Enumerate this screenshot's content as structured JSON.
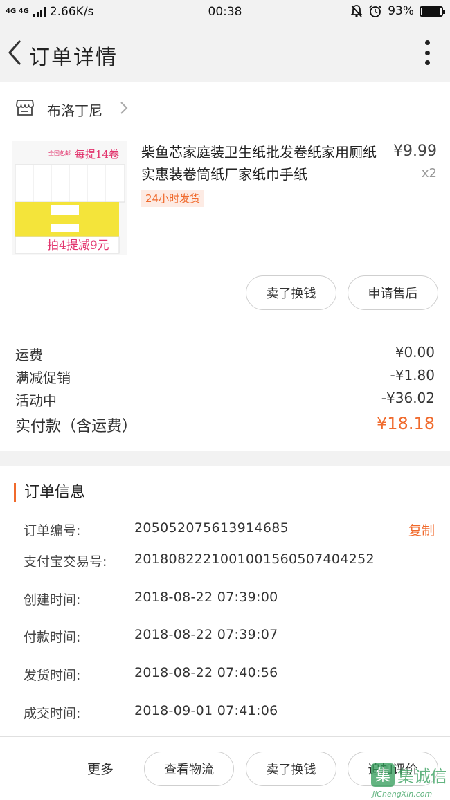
{
  "status_bar": {
    "signal": "4G 4G",
    "speed": "2.66K/s",
    "time": "00:38",
    "battery": "93%",
    "battery_level": 0.93
  },
  "header": {
    "title": "订单详情"
  },
  "store": {
    "name": "布洛丁尼"
  },
  "product": {
    "title": "柴鱼芯家庭装卫生纸批发卷纸家用厕纸实惠装卷筒纸厂家纸巾手纸",
    "price": "¥9.99",
    "quantity": "x2",
    "tag": "24小时发货",
    "image_texts": {
      "banner_small": "全国包邮",
      "banner_big": "每提14卷",
      "promo": "拍4提减9元"
    }
  },
  "actions": {
    "exchange": "卖了换钱",
    "after_sale": "申请售后"
  },
  "summary": {
    "shipping_label": "运费",
    "shipping_value": "¥0.00",
    "discount_label": "满减促销",
    "discount_value": "-¥1.80",
    "event_label": "活动中",
    "event_value": "-¥36.02",
    "paid_label": "实付款（含运费）",
    "paid_value": "¥18.18"
  },
  "order_info": {
    "title": "订单信息",
    "rows": [
      {
        "label": "订单编号:",
        "value": "2050520756139​14685"
      },
      {
        "label": "支付宝交易号:",
        "value": "2018082221001001560507404252"
      },
      {
        "label": "创建时间:",
        "value": "2018-08-22 07:39:00"
      },
      {
        "label": "付款时间:",
        "value": "2018-08-22 07:39:07"
      },
      {
        "label": "发货时间:",
        "value": "2018-08-22 07:40:56"
      },
      {
        "label": "成交时间:",
        "value": "2018-09-01 07:41:06"
      }
    ],
    "copy_label": "复制"
  },
  "footer": {
    "more": "更多",
    "logistics": "查看物流",
    "exchange": "卖了换钱",
    "review": "追加评价"
  },
  "watermark": {
    "text": "集诚信",
    "url_text": "JiChengXin.com"
  },
  "colors": {
    "accent": "#f06a2c",
    "tag_bg": "#fdebe4",
    "page_bg": "#f2f2f2"
  }
}
